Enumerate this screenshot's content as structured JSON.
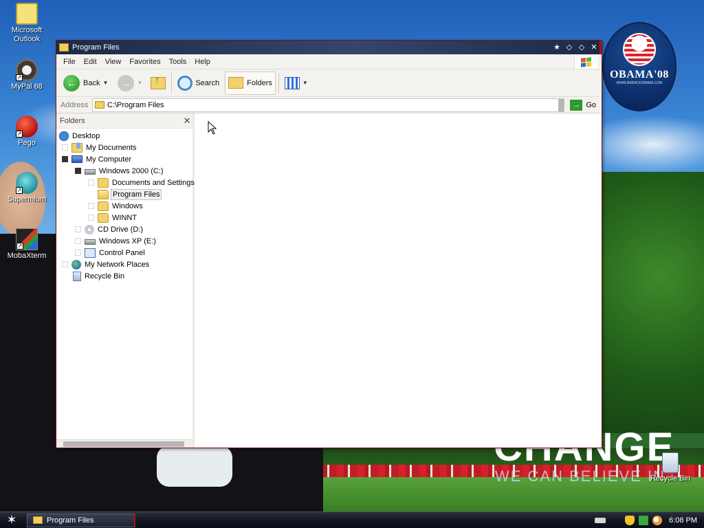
{
  "desktop": {
    "icons": [
      {
        "label": "Microsoft Outlook"
      },
      {
        "label": "MyPal 68"
      },
      {
        "label": "Pego"
      },
      {
        "label": "Supermium"
      },
      {
        "label": "MobaXterm"
      },
      {
        "label": "Recycle Bin"
      }
    ],
    "wallpaper": {
      "logo_name": "OBAMA'08",
      "logo_url": "WWW.BARACKOBAMA.COM",
      "headline": "CHANGE",
      "subline": "WE CAN BELIEVE IN"
    }
  },
  "window": {
    "title": "Program Files",
    "menu": [
      "File",
      "Edit",
      "View",
      "Favorites",
      "Tools",
      "Help"
    ],
    "toolbar": {
      "back_label": "Back",
      "search_label": "Search",
      "folders_label": "Folders"
    },
    "address": {
      "label": "Address",
      "value": "C:\\Program Files",
      "go_label": "Go"
    },
    "folders_pane": {
      "title": "Folders",
      "tree": [
        {
          "label": "Desktop"
        },
        {
          "label": "My Documents"
        },
        {
          "label": "My Computer"
        },
        {
          "label": "Windows 2000 (C:)"
        },
        {
          "label": "Documents and Settings"
        },
        {
          "label": "Program Files"
        },
        {
          "label": "Windows"
        },
        {
          "label": "WINNT"
        },
        {
          "label": "CD Drive (D:)"
        },
        {
          "label": "Windows XP (E:)"
        },
        {
          "label": "Control Panel"
        },
        {
          "label": "My Network Places"
        },
        {
          "label": "Recycle Bin"
        }
      ]
    }
  },
  "taskbar": {
    "task_label": "Program Files",
    "clock": "6:08 PM"
  },
  "colors": {
    "title_bar": "#1b2a47",
    "accent_red": "#b01010",
    "selection": "#f0f0f0"
  }
}
